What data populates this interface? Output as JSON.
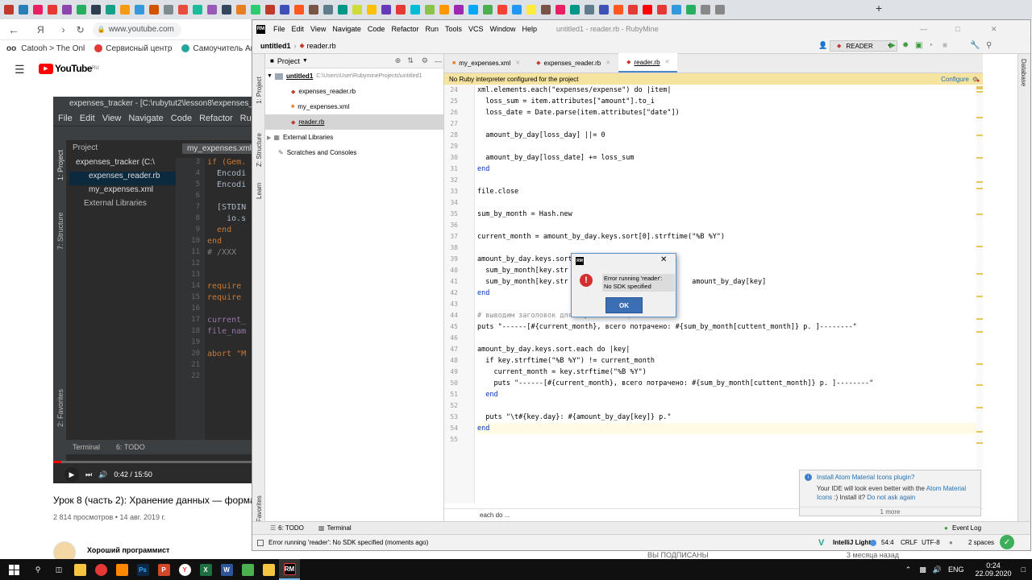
{
  "browser": {
    "url": "www.youtube.com",
    "bookmarks": [
      "Catooh > The Onl",
      "Сервисный центр",
      "Самоучитель Анг"
    ]
  },
  "youtube": {
    "logo": "YouTube",
    "region": "RU",
    "video_title": "Урок 8 (часть 2): Хранение данных — форма",
    "views": "2 814 просмотров • 14 авг. 2019 г.",
    "channel": "Хороший программист",
    "time": "0:42 / 15:50",
    "subscribed": "ВЫ ПОДПИСАНЫ",
    "ago": "3 месяца назад"
  },
  "video_ide": {
    "title": "expenses_tracker - [C:\\rubytut2\\lesson8\\expenses_t",
    "menu": [
      "File",
      "Edit",
      "View",
      "Navigate",
      "Code",
      "Refactor",
      "Run"
    ],
    "project_label": "Project",
    "tab": "my_expenses.xml",
    "tree": [
      "expenses_tracker (C:\\",
      "expenses_reader.rb",
      "my_expenses.xml",
      "External Libraries"
    ],
    "lines": [
      "3",
      "4",
      "5",
      "6",
      "7",
      "8",
      "9",
      "10",
      "11",
      "12",
      "13",
      "14",
      "15",
      "16",
      "17",
      "18",
      "19",
      "20",
      "21",
      "22"
    ],
    "code": [
      "if (Gem.",
      "  Encodi",
      "  Encodi",
      "",
      "  [STDIN",
      "    io.s",
      "  end",
      "end",
      "# /XXX",
      "",
      "",
      "require ",
      "require ",
      "",
      "current_",
      "file_nam",
      "",
      "abort \"M",
      "",
      ""
    ],
    "bottom": [
      "Terminal",
      "6: TODO"
    ],
    "side": [
      "1: Project",
      "7: Structure",
      "2: Favorites"
    ]
  },
  "rubymine": {
    "menu": [
      "File",
      "Edit",
      "View",
      "Navigate",
      "Code",
      "Refactor",
      "Run",
      "Tools",
      "VCS",
      "Window",
      "Help"
    ],
    "window_title": "untitled1 - reader.rb - RubyMine",
    "nav_project": "untitled1",
    "nav_file": "reader.rb",
    "run_config": "READER",
    "project_label": "Project",
    "tree": [
      {
        "label": "untitled1",
        "path": "C:\\Users\\User\\RubymineProjects\\untitled1"
      },
      {
        "label": "expenses_reader.rb"
      },
      {
        "label": "my_expenses.xml"
      },
      {
        "label": "reader.rb"
      },
      {
        "label": "External Libraries"
      },
      {
        "label": "Scratches and Consoles"
      }
    ],
    "tabs": [
      "my_expenses.xml",
      "expenses_reader.rb",
      "reader.rb"
    ],
    "banner": "No Ruby interpreter configured for the project",
    "banner_action": "Configure",
    "line_numbers": [
      "24",
      "25",
      "26",
      "27",
      "28",
      "29",
      "30",
      "31",
      "32",
      "33",
      "34",
      "35",
      "36",
      "37",
      "38",
      "39",
      "40",
      "41",
      "42",
      "43",
      "44",
      "45",
      "46",
      "47",
      "48",
      "49",
      "50",
      "51",
      "52",
      "53",
      "54",
      "55"
    ],
    "code": [
      "xml.elements.each(\"expenses/expense\") do |item|",
      "  loss_sum = item.attributes[\"amount\"].to_i",
      "  loss_date = Date.parse(item.attributes[\"date\"])",
      "",
      "  amount_by_day[loss_day] ||= 0",
      "",
      "  amount_by_day[loss_date] += loss_sum",
      "end",
      "",
      "file.close",
      "",
      "sum_by_month = Hash.new",
      "",
      "current_month = amount_by_day.keys.sort[0].strftime(\"%B %Y\")",
      "",
      "amount_by_day.keys.sort",
      "  sum_by_month[key.str",
      "  sum_by_month[key.str                              amount_by_day[key]",
      "end",
      "",
      "# выводим заголовок для первого месяца",
      "puts \"------[#{current_month}, всего потрачено: #{sum_by_month[cuttent_month]} р. ]--------\"",
      "",
      "amount_by_day.keys.sort.each do |key|",
      "  if key.strftime(\"%B %Y\") != current_month",
      "    current_month = key.strftime(\"%B %Y\")",
      "    puts \"------[#{current_month}, всего потрачено: #{sum_by_month[cuttent_month]} р. ]--------\"",
      "  end",
      "",
      "  puts \"\\t#{key.day}: #{amount_by_day[key]} р.\"",
      "end",
      ""
    ],
    "breadcrumb": "each do ...",
    "side_labels": [
      "1: Project",
      "Z: Structure",
      "Learn",
      "2: Favorites"
    ],
    "right_label": "Database",
    "bottom_tools": [
      "6: TODO",
      "Terminal"
    ],
    "event_log": "Event Log",
    "status_msg": "Error running 'reader': No SDK specified (moments ago)",
    "theme": "IntelliJ Light",
    "position": "54:4",
    "line_sep": "CRLF",
    "encoding": "UTF-8",
    "indent": "2 spaces",
    "notification": {
      "title": "Install Atom Material Icons plugin?",
      "body": "Your IDE will look even better with the",
      "link": "Atom Material Icons",
      "body2": ":) Install it?",
      "dismiss": "Do not ask again",
      "more": "1 more"
    }
  },
  "dialog": {
    "message_line1": "Error running 'reader':",
    "message_line2": "No SDK specified",
    "ok": "OK"
  },
  "taskbar": {
    "lang": "ENG",
    "time": "0:24",
    "date": "22.09.2020"
  }
}
